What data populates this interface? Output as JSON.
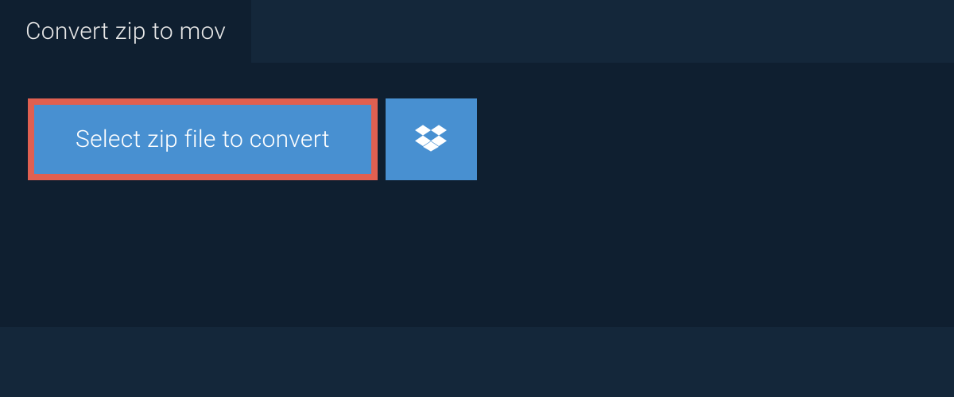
{
  "tab": {
    "title": "Convert zip to mov"
  },
  "actions": {
    "select_file_label": "Select zip file to convert"
  },
  "colors": {
    "background": "#14273a",
    "panel": "#0f1f30",
    "button": "#4890d1",
    "highlight_border": "#e06051"
  }
}
